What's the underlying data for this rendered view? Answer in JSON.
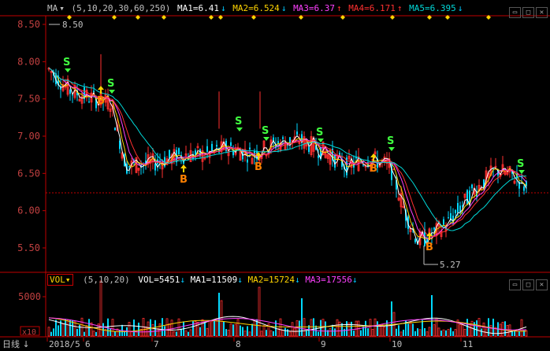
{
  "main": {
    "indicator": "MA",
    "params": "(5,10,20,30,60,250)",
    "ma1": "MA1=6.41",
    "ma2": "MA2=6.524",
    "ma3": "MA3=6.37",
    "ma4": "MA4=6.171",
    "ma5": "MA5=6.395",
    "colors": {
      "ma1": "#ffffff",
      "ma2": "#ffd400",
      "ma3": "#ff40ff",
      "ma4": "#ff3030",
      "ma5": "#00d8d8",
      "up": "#ff3030",
      "down": "#00d8ff"
    },
    "yticks": [
      "8.50",
      "8.00",
      "7.50",
      "7.00",
      "6.50",
      "6.00",
      "5.50"
    ],
    "high_label": "8.50",
    "low_label": "5.27"
  },
  "volume": {
    "indicator": "VOL",
    "params": "(5,10,20)",
    "vol": "VOL=5451",
    "ma1": "MA1=11509",
    "ma2": "MA2=15724",
    "ma3": "MA3=17556",
    "ytick": "5000",
    "unit": "x10"
  },
  "timeline": {
    "period": "日线",
    "labels": [
      "2018/5",
      "6",
      "7",
      "8",
      "9",
      "10",
      "11"
    ]
  },
  "signals": {
    "buy": "B",
    "sell": "S"
  }
}
